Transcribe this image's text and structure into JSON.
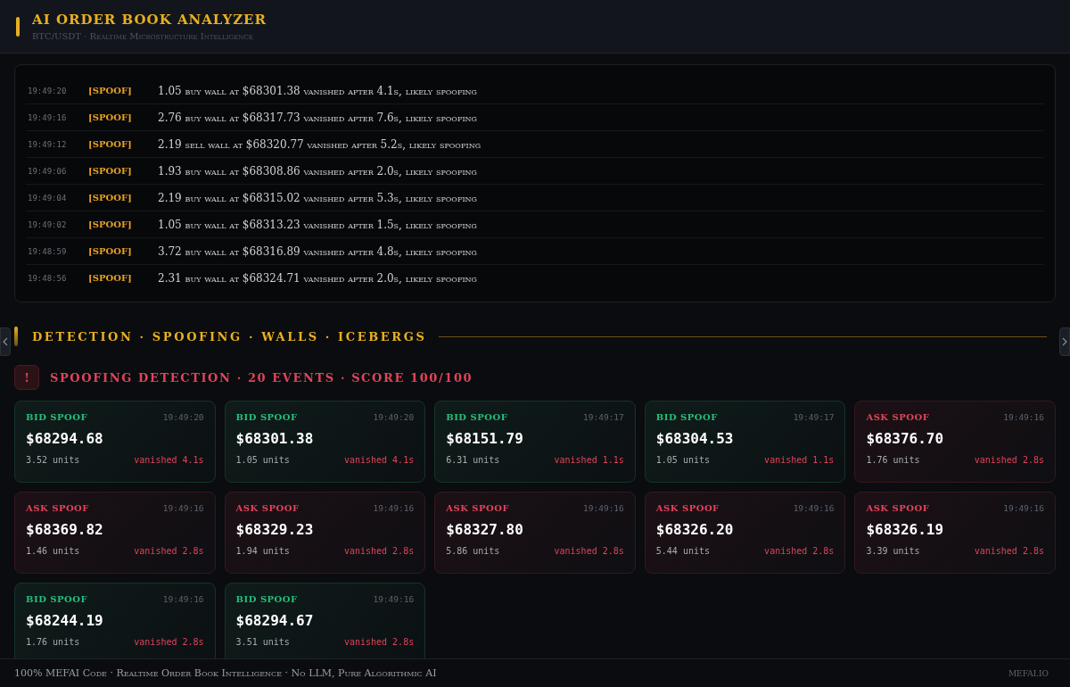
{
  "header": {
    "title": "AI ORDER BOOK ANALYZER",
    "subtitle": "BTC/USDT · Realtime Microstructure Intelligence"
  },
  "log": [
    {
      "time": "19:49:20",
      "tag": "[SPOOF]",
      "message": "1.05 buy wall at $68301.38 vanished after 4.1s, likely spoofing"
    },
    {
      "time": "19:49:16",
      "tag": "[SPOOF]",
      "message": "2.76 buy wall at $68317.73 vanished after 7.6s, likely spoofing"
    },
    {
      "time": "19:49:12",
      "tag": "[SPOOF]",
      "message": "2.19 sell wall at $68320.77 vanished after 5.2s, likely spoofing"
    },
    {
      "time": "19:49:06",
      "tag": "[SPOOF]",
      "message": "1.93 buy wall at $68308.86 vanished after 2.0s, likely spoofing"
    },
    {
      "time": "19:49:04",
      "tag": "[SPOOF]",
      "message": "2.19 buy wall at $68315.02 vanished after 5.3s, likely spoofing"
    },
    {
      "time": "19:49:02",
      "tag": "[SPOOF]",
      "message": "1.05 buy wall at $68313.23 vanished after 1.5s, likely spoofing"
    },
    {
      "time": "19:48:59",
      "tag": "[SPOOF]",
      "message": "3.72 buy wall at $68316.89 vanished after 4.8s, likely spoofing"
    },
    {
      "time": "19:48:56",
      "tag": "[SPOOF]",
      "message": "2.31 buy wall at $68324.71 vanished after 2.0s, likely spoofing"
    }
  ],
  "section_title": "DETECTION · SPOOFING · WALLS · ICEBERGS",
  "alert": {
    "icon": "!",
    "text": "SPOOFING DETECTION · 20 EVENTS · SCORE 100/100"
  },
  "cards": [
    {
      "kind": "bid",
      "label": "BID SPOOF",
      "time": "19:49:20",
      "price": "$68294.68",
      "units": "3.52 units",
      "vanished": "vanished 4.1s"
    },
    {
      "kind": "bid",
      "label": "BID SPOOF",
      "time": "19:49:20",
      "price": "$68301.38",
      "units": "1.05 units",
      "vanished": "vanished 4.1s"
    },
    {
      "kind": "bid",
      "label": "BID SPOOF",
      "time": "19:49:17",
      "price": "$68151.79",
      "units": "6.31 units",
      "vanished": "vanished 1.1s"
    },
    {
      "kind": "bid",
      "label": "BID SPOOF",
      "time": "19:49:17",
      "price": "$68304.53",
      "units": "1.05 units",
      "vanished": "vanished 1.1s"
    },
    {
      "kind": "ask",
      "label": "ASK SPOOF",
      "time": "19:49:16",
      "price": "$68376.70",
      "units": "1.76 units",
      "vanished": "vanished 2.8s"
    },
    {
      "kind": "ask",
      "label": "ASK SPOOF",
      "time": "19:49:16",
      "price": "$68369.82",
      "units": "1.46 units",
      "vanished": "vanished 2.8s"
    },
    {
      "kind": "ask",
      "label": "ASK SPOOF",
      "time": "19:49:16",
      "price": "$68329.23",
      "units": "1.94 units",
      "vanished": "vanished 2.8s"
    },
    {
      "kind": "ask",
      "label": "ASK SPOOF",
      "time": "19:49:16",
      "price": "$68327.80",
      "units": "5.86 units",
      "vanished": "vanished 2.8s"
    },
    {
      "kind": "ask",
      "label": "ASK SPOOF",
      "time": "19:49:16",
      "price": "$68326.20",
      "units": "5.44 units",
      "vanished": "vanished 2.8s"
    },
    {
      "kind": "ask",
      "label": "ASK SPOOF",
      "time": "19:49:16",
      "price": "$68326.19",
      "units": "3.39 units",
      "vanished": "vanished 2.8s"
    },
    {
      "kind": "bid",
      "label": "BID SPOOF",
      "time": "19:49:16",
      "price": "$68244.19",
      "units": "1.76 units",
      "vanished": "vanished 2.8s"
    },
    {
      "kind": "bid",
      "label": "BID SPOOF",
      "time": "19:49:16",
      "price": "$68294.67",
      "units": "3.51 units",
      "vanished": "vanished 2.8s"
    }
  ],
  "footer": {
    "text": "100% MEFAI Code · Realtime Order Book Intelligence · No LLM, Pure Algorithmic AI",
    "brand": "MEFAI.IO"
  }
}
